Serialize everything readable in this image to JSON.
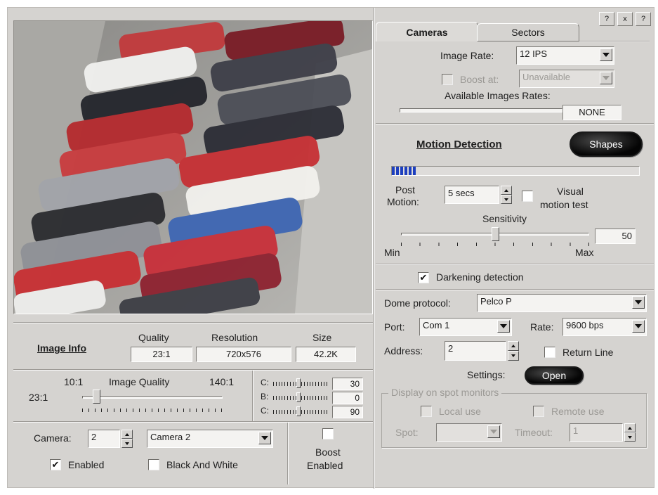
{
  "window_buttons": [
    "?",
    "x",
    "?"
  ],
  "tabs": [
    {
      "label": "Cameras",
      "active": true
    },
    {
      "label": "Sectors",
      "active": false
    }
  ],
  "image_rate": {
    "label": "Image Rate:",
    "value": "12 IPS"
  },
  "boost_at": {
    "label": "Boost at:",
    "value": "Unavailable"
  },
  "available_rates": {
    "label": "Available Images Rates:",
    "value": "NONE"
  },
  "motion": {
    "title": "Motion Detection",
    "shapes_button": "Shapes",
    "level_fraction": 0.1,
    "post_label_1": "Post",
    "post_label_2": "Motion:",
    "post_value": "5 secs",
    "visual_label_1": "Visual",
    "visual_label_2": "motion test",
    "sensitivity_label": "Sensitivity",
    "sensitivity_value": "50",
    "sensitivity_fraction": 0.5,
    "min_label": "Min",
    "max_label": "Max"
  },
  "darkening": {
    "label": "Darkening detection",
    "checked": true
  },
  "dome": {
    "protocol_label": "Dome protocol:",
    "protocol_value": "Pelco P",
    "port_label": "Port:",
    "port_value": "Com 1",
    "rate_label": "Rate:",
    "rate_value": "9600 bps",
    "address_label": "Address:",
    "address_value": "2",
    "return_label": "Return Line",
    "settings_label": "Settings:",
    "open_button": "Open"
  },
  "spot": {
    "group_label": "Display on spot monitors",
    "local_label": "Local use",
    "remote_label": "Remote use",
    "spot_label": "Spot:",
    "timeout_label": "Timeout:",
    "timeout_value": "1"
  },
  "image_info": {
    "title": "Image Info",
    "quality_header": "Quality",
    "resolution_header": "Resolution",
    "size_header": "Size",
    "quality_value": "23:1",
    "resolution_value": "720x576",
    "size_value": "42.2K"
  },
  "image_quality": {
    "min_label": "10:1",
    "title": "Image Quality",
    "max_label": "140:1",
    "current_label": "23:1",
    "fraction": 0.1
  },
  "color_sliders": [
    {
      "label": "C:",
      "value": "30",
      "fraction": 0.45
    },
    {
      "label": "B:",
      "value": "0",
      "fraction": 0.45
    },
    {
      "label": "C:",
      "value": "90",
      "fraction": 0.45
    }
  ],
  "camera": {
    "label": "Camera:",
    "number": "2",
    "name": "Camera 2",
    "enabled_label": "Enabled",
    "bw_label": "Black And White"
  },
  "boost": {
    "label_1": "Boost",
    "label_2": "Enabled"
  }
}
